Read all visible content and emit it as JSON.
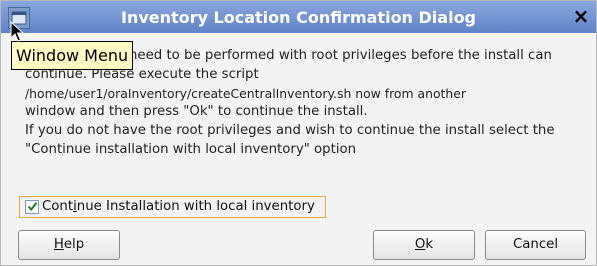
{
  "window": {
    "title": "Inventory Location Confirmation Dialog",
    "close_glyph": "×"
  },
  "tooltip": {
    "text": "Window Menu"
  },
  "message": {
    "line1": "need to be performed with root privileges before the install can",
    "line2": "continue. Please execute the script",
    "line3": "/home/user1/oraInventory/createCentralInventory.sh now from another",
    "line4": "window and then press \"Ok\" to continue the install.",
    "line5": "If you do not have the root privileges and wish to continue the install select the",
    "line6": "\"Continue installation with local inventory\" option"
  },
  "checkbox": {
    "label_pre": "Cont",
    "label_mnemonic": "i",
    "label_post": "nue Installation with local inventory",
    "checked": true
  },
  "buttons": {
    "help_mnemonic": "H",
    "help_rest": "elp",
    "ok_mnemonic": "O",
    "ok_rest": "k",
    "cancel_label": "Cancel"
  }
}
